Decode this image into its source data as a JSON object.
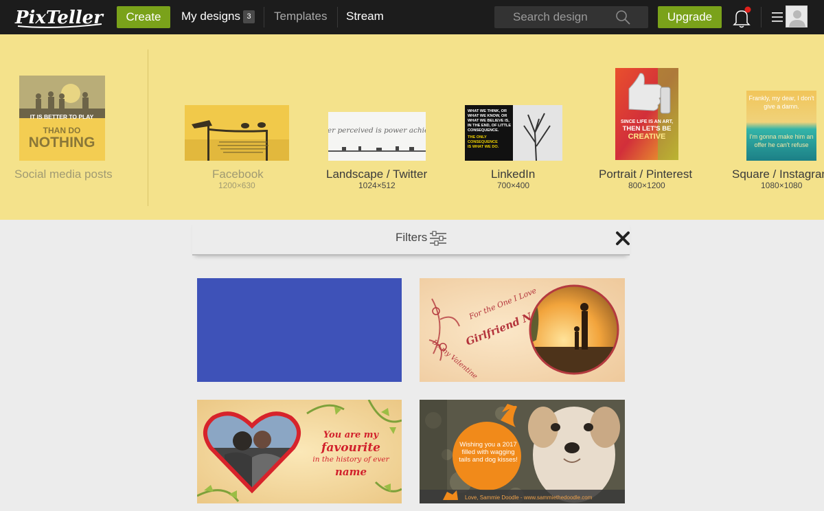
{
  "nav": {
    "logo_text": "PixTeller",
    "create_label": "Create",
    "my_designs_label": "My designs",
    "my_designs_count": "3",
    "templates_label": "Templates",
    "stream_label": "Stream",
    "search_placeholder": "Search design",
    "upgrade_label": "Upgrade",
    "colors": {
      "accent": "#7aa21a",
      "bar": "#1c1c1c",
      "notify": "#e0201b"
    }
  },
  "formats": {
    "background": "#f4e28b",
    "items": [
      {
        "label": "Social media posts",
        "size": "",
        "thumb_text": "IT IS BETTER TO PLAY THAN DO NOTHING"
      },
      {
        "label": "Facebook",
        "size": "1200×630"
      },
      {
        "label": "Landscape / Twitter",
        "size": "1024×512",
        "thumb_text": "Power perceived is power achieved"
      },
      {
        "label": "LinkedIn",
        "size": "700×400",
        "thumb_text": "WHAT WE THINK, OR WHAT WE KNOW, OR WHAT WE BELIEVE IS, IN THE END, OF LITTLE CONSEQUENCE. THE ONLY CONSEQUENCE IS WHAT WE DO."
      },
      {
        "label": "Portrait / Pinterest",
        "size": "800×1200",
        "thumb_text": "SINCE LIFE IS AN ART, THEN LET'S BE CREATIVE"
      },
      {
        "label": "Square / Instagram",
        "size": "1080×1080",
        "thumb_text_top": "Frankly, my dear, I don't give a damn.",
        "thumb_text_bottom": "I'm gonna make him an offer he can't refuse"
      }
    ]
  },
  "filters": {
    "label": "Filters"
  },
  "cards": [
    {
      "name": "blue-blank",
      "color": "#3e52b8"
    },
    {
      "name": "girlfriend",
      "line1": "For the One I Love",
      "line2": "Girlfriend Name",
      "line3": "Be my Valentine"
    },
    {
      "name": "favourite",
      "line1": "You are my",
      "line2": "favourite",
      "line3": "in the history of ever",
      "line4": "name"
    },
    {
      "name": "dog",
      "bubble": "Wishing you a 2017 filled with wagging tails and dog kisses!",
      "footer": "Love, Sammie Doodle - www.sammiethedoodle.com"
    }
  ]
}
